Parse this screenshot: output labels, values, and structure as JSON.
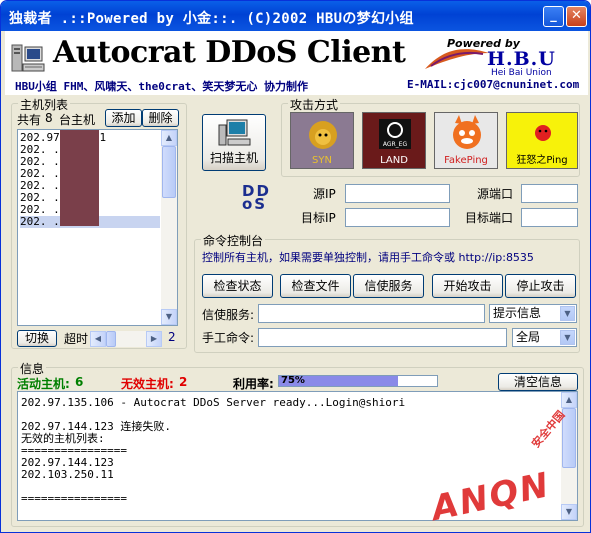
{
  "window": {
    "title": "独裁者 .::Powered by 小金::. (C)2002 HBUの梦幻小组",
    "minimize_glyph": "_",
    "close_glyph": "✕"
  },
  "header": {
    "app_title": "Autocrat DDoS Client",
    "credits": "HBU小组 FHM、风啸天、the0crat、笑天梦无心 协力制作",
    "email": "E-MAIL:cjc007@cnuninet.com",
    "powered_by": "Powered by",
    "hbu_logo": "H.B.U",
    "hbu_sub": "Hei Bai Union"
  },
  "host_list": {
    "group_label": "主机列表",
    "count_prefix": "共有",
    "count": "8",
    "count_suffix": "台主机",
    "add_button": "添加",
    "delete_button": "删除",
    "items": [
      "202.97.135.11",
      "202.  .42",
      "202.  .4.67",
      "202.  .61",
      "202.  .2",
      "202.  .56",
      "202.  .5.106",
      "202.  .4.123"
    ],
    "selected_index": 7,
    "switch_button": "切换",
    "timeout_label": "超时",
    "timeout_value": "2"
  },
  "scan": {
    "button_label": "扫描主机"
  },
  "attack_mode": {
    "group_label": "攻击方式",
    "options": [
      {
        "label": "SYN",
        "icon": "lion-icon",
        "bg": "#8B7A92"
      },
      {
        "label": "LAND",
        "icon": "agr-eg-icon",
        "bg": "#6A1A1A"
      },
      {
        "label": "FakePing",
        "icon": "fox-icon",
        "bg": "#E8E8E8"
      },
      {
        "label": "狂怒之Ping",
        "icon": "angry-face-icon",
        "bg": "#F7F20A"
      }
    ]
  },
  "ddos_logo": {
    "line1": "DD",
    "line2": "oS"
  },
  "addresses": {
    "src_ip_label": "源IP",
    "dst_ip_label": "目标IP",
    "src_port_label": "源端口",
    "dst_port_label": "目标端口",
    "src_ip": "",
    "dst_ip": "",
    "src_port": "",
    "dst_port": ""
  },
  "command": {
    "group_label": "命令控制台",
    "hint": "控制所有主机，如果需要单独控制，请用手工命令或 http://ip:8535",
    "buttons": [
      "检查状态",
      "检查文件",
      "信使服务",
      "开始攻击",
      "停止攻击"
    ],
    "messenger_label": "信使服务:",
    "messenger_value": "",
    "messenger_select": "提示信息",
    "manual_label": "手工命令:",
    "manual_value": "",
    "manual_select": "全局"
  },
  "info": {
    "group_label": "信息",
    "active_label": "活动主机:",
    "active_count": "6",
    "invalid_label": "无效主机:",
    "invalid_count": "2",
    "usage_label": "利用率:",
    "usage_percent": 75,
    "usage_text": "75%",
    "clear_button": "清空信息",
    "log_lines": [
      "202.97.135.106 - Autocrat DDoS Server ready...Login@shiori",
      "",
      "202.97.144.123 连接失败.",
      "无效的主机列表:",
      "================",
      "202.97.144.123",
      "202.103.250.11",
      "",
      "================"
    ]
  },
  "watermark": {
    "text": "ANQN",
    "sub": "安全中国"
  },
  "colors": {
    "accent": "#0A5FE8",
    "active": "#007F00",
    "invalid": "#E00000",
    "progress": "#8A8AE8"
  }
}
